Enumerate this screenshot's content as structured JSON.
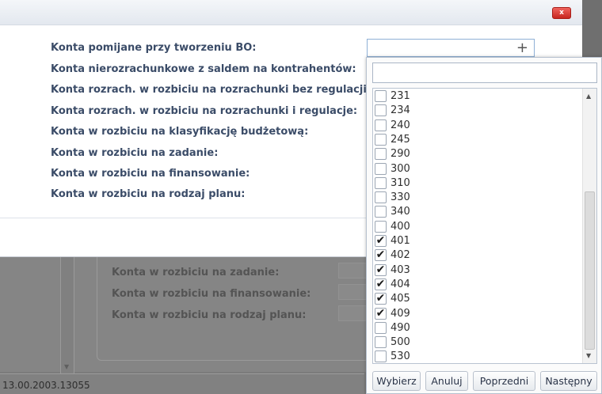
{
  "background": {
    "labels": [
      "Konta w rozbiciu na zadanie:",
      "Konta w rozbiciu na finansowanie:",
      "Konta w rozbiciu na rodzaj planu:"
    ],
    "status_text": "13.00.2003.13055"
  },
  "dialog": {
    "close_label": "x",
    "labels": [
      "Konta pomijane przy tworzeniu BO:",
      "Konta nierozrachunkowe z saldem na kontrahentów:",
      "Konta rozrach. w rozbiciu na rozrachunki bez regulacji:",
      "Konta rozrach. w rozbiciu na rozrachunki i regulacje:",
      "Konta w rozbiciu na klasyfikację budżetową:",
      "Konta w rozbiciu na zadanie:",
      "Konta w rozbiciu na finansowanie:",
      "Konta w rozbiciu na rodzaj planu:"
    ]
  },
  "multiselect": {
    "value": "",
    "expand_icon": "plus-icon",
    "filter_value": "",
    "items": [
      {
        "label": "231",
        "checked": false
      },
      {
        "label": "234",
        "checked": false
      },
      {
        "label": "240",
        "checked": false
      },
      {
        "label": "245",
        "checked": false
      },
      {
        "label": "290",
        "checked": false
      },
      {
        "label": "300",
        "checked": false
      },
      {
        "label": "310",
        "checked": false
      },
      {
        "label": "330",
        "checked": false
      },
      {
        "label": "340",
        "checked": false
      },
      {
        "label": "400",
        "checked": false
      },
      {
        "label": "401",
        "checked": true
      },
      {
        "label": "402",
        "checked": true
      },
      {
        "label": "403",
        "checked": true
      },
      {
        "label": "404",
        "checked": true
      },
      {
        "label": "405",
        "checked": true
      },
      {
        "label": "409",
        "checked": true
      },
      {
        "label": "490",
        "checked": false
      },
      {
        "label": "500",
        "checked": false
      },
      {
        "label": "530",
        "checked": false
      }
    ],
    "buttons": {
      "select": "Wybierz",
      "cancel": "Anuluj",
      "previous": "Poprzedni",
      "next": "Następny"
    }
  }
}
